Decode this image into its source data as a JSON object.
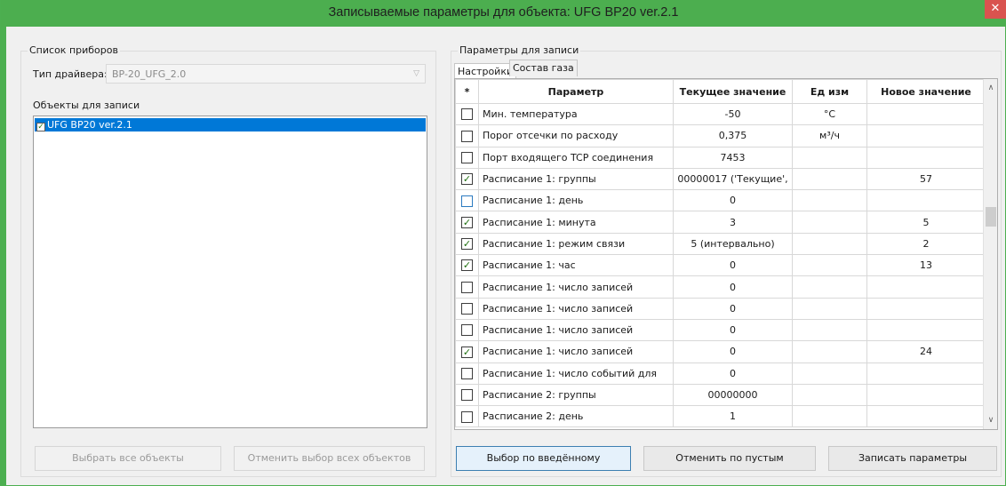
{
  "window": {
    "title": "Записываемые параметры для объекта: UFG BP20 ver.2.1",
    "close_glyph": "✕"
  },
  "left": {
    "group_title": "Список приборов",
    "driver_label": "Тип драйвера:",
    "driver_value": "BP-20_UFG_2.0",
    "objects_label": "Объекты для записи",
    "objects": [
      {
        "label": "UFG BP20 ver.2.1",
        "checked": true
      }
    ],
    "select_all_label": "Выбрать все объекты",
    "deselect_all_label": "Отменить выбор всех объектов"
  },
  "right": {
    "group_title": "Параметры для записи",
    "tabs": [
      {
        "label": "Настройки"
      },
      {
        "label": "Состав газа"
      }
    ],
    "columns": [
      "*",
      "Параметр",
      "Текущее значение",
      "Ед изм",
      "Новое значение"
    ],
    "rows": [
      {
        "checked": false,
        "param": "Мин. температура",
        "current": "-50",
        "unit": "°C",
        "new": ""
      },
      {
        "checked": false,
        "param": "Порог отсечки по расходу",
        "current": "0,375",
        "unit": "м³/ч",
        "new": ""
      },
      {
        "checked": false,
        "param": "Порт входящего TCP соединения",
        "current": "7453",
        "unit": "",
        "new": ""
      },
      {
        "checked": true,
        "param": "Расписание 1: группы",
        "current": "00000017 ('Текущие',",
        "unit": "",
        "new": "57"
      },
      {
        "checked": false,
        "param": "Расписание 1: день",
        "current": "0",
        "unit": "",
        "new": ""
      },
      {
        "checked": true,
        "param": "Расписание 1: минута",
        "current": "3",
        "unit": "",
        "new": "5"
      },
      {
        "checked": true,
        "param": "Расписание 1: режим связи",
        "current": "5 (интервально)",
        "unit": "",
        "new": "2"
      },
      {
        "checked": true,
        "param": "Расписание 1: час",
        "current": "0",
        "unit": "",
        "new": "13"
      },
      {
        "checked": false,
        "param": "Расписание 1: число записей",
        "current": "0",
        "unit": "",
        "new": ""
      },
      {
        "checked": false,
        "param": "Расписание 1: число записей",
        "current": "0",
        "unit": "",
        "new": ""
      },
      {
        "checked": false,
        "param": "Расписание 1: число записей",
        "current": "0",
        "unit": "",
        "new": ""
      },
      {
        "checked": true,
        "param": "Расписание 1: число записей",
        "current": "0",
        "unit": "",
        "new": "24"
      },
      {
        "checked": false,
        "param": "Расписание 1: число событий для",
        "current": "0",
        "unit": "",
        "new": ""
      },
      {
        "checked": false,
        "param": "Расписание 2: группы",
        "current": "00000000",
        "unit": "",
        "new": ""
      },
      {
        "checked": false,
        "param": "Расписание 2: день",
        "current": "1",
        "unit": "",
        "new": ""
      }
    ],
    "buttons": {
      "select_entered": "Выбор по введённому",
      "cancel_empty": "Отменить по пустым",
      "write_params": "Записать параметры"
    }
  },
  "icons": {
    "check": "✓",
    "combo_arrow": "▽",
    "scroll_up": "∧",
    "scroll_down": "∨"
  },
  "colors": {
    "titlebar": "#4cae4f",
    "close": "#d9534f",
    "selection": "#0078d7"
  }
}
